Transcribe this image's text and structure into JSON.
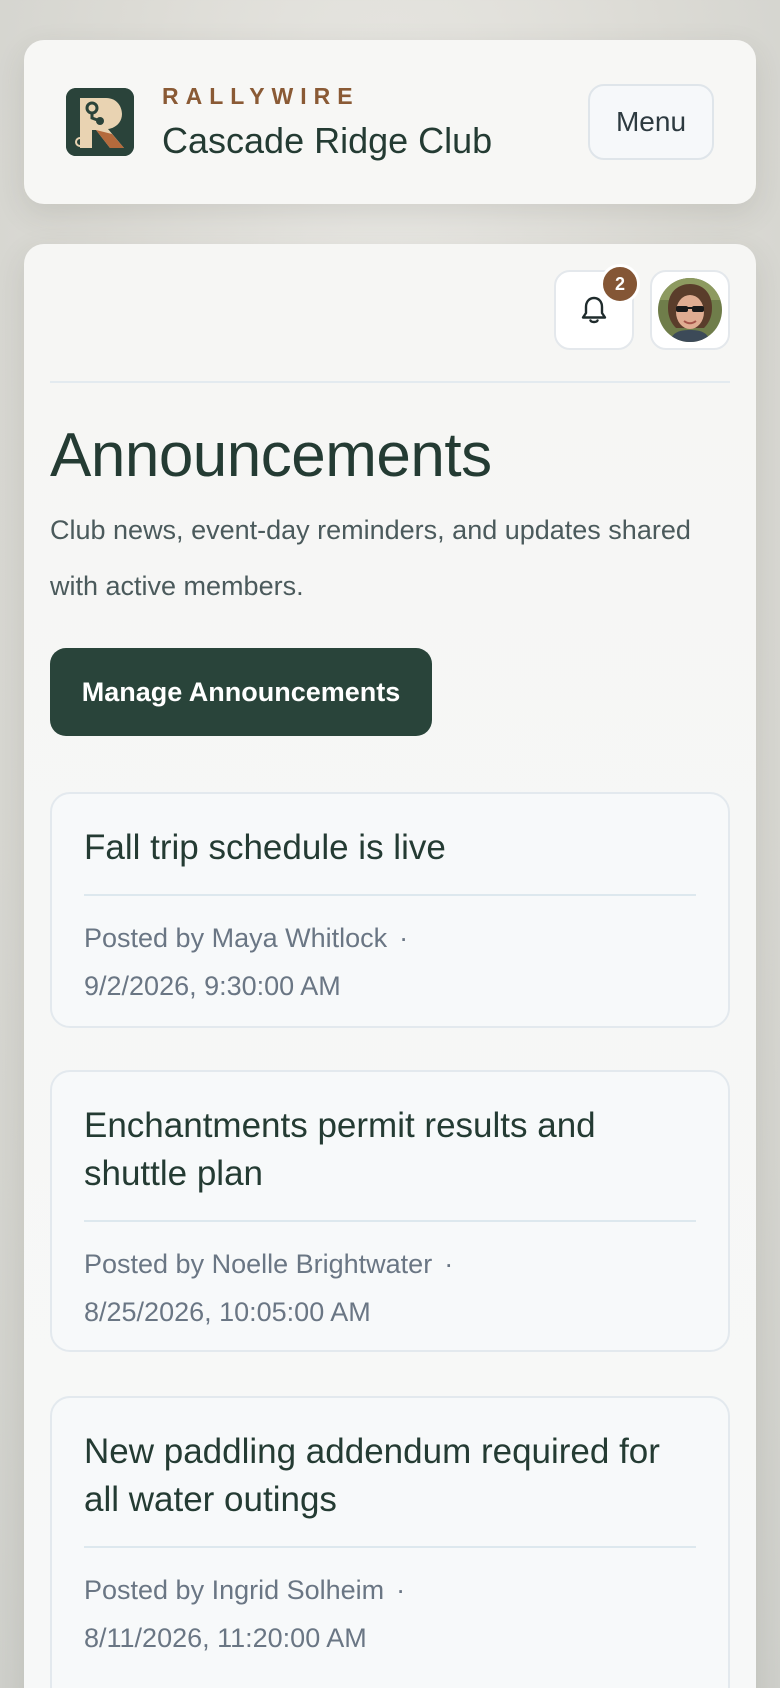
{
  "header": {
    "brand": "RALLYWIRE",
    "club_name": "Cascade Ridge Club",
    "menu_label": "Menu"
  },
  "toolbar": {
    "notification_count": "2"
  },
  "page": {
    "title": "Announcements",
    "description": "Club news, event-day reminders, and updates shared with active members.",
    "manage_label": "Manage Announcements"
  },
  "announcements": [
    {
      "title": "Fall trip schedule is live",
      "posted_by": "Posted by Maya Whitlock",
      "separator": "·",
      "date": "9/2/2026, 9:30:00 AM"
    },
    {
      "title": "Enchantments permit results and shuttle plan",
      "posted_by": "Posted by Noelle Brightwater",
      "separator": "·",
      "date": "8/25/2026, 10:05:00 AM"
    },
    {
      "title": "New paddling addendum required for all water outings",
      "posted_by": "Posted by Ingrid Solheim",
      "separator": "·",
      "date": "8/11/2026, 11:20:00 AM"
    }
  ],
  "colors": {
    "primary": "#29443a",
    "accent": "#845635",
    "text": "#243b33",
    "muted": "#6a7684"
  }
}
